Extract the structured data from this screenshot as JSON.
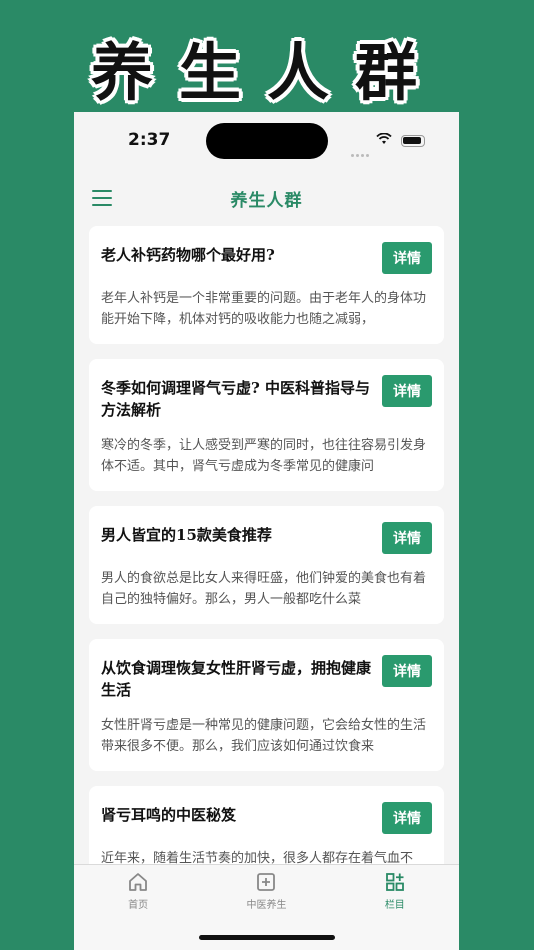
{
  "banner": {
    "title": "养生人群"
  },
  "status_bar": {
    "time": "2:37"
  },
  "navbar": {
    "title": "养生人群"
  },
  "articles": [
    {
      "title": "老人补钙药物哪个最好用?",
      "button": "详情",
      "excerpt": "老年人补钙是一个非常重要的问题。由于老年人的身体功能开始下降，机体对钙的吸收能力也随之减弱，"
    },
    {
      "title": "冬季如何调理肾气亏虚? 中医科普指导与方法解析",
      "button": "详情",
      "excerpt": "寒冷的冬季，让人感受到严寒的同时，也往往容易引发身体不适。其中，肾气亏虚成为冬季常见的健康问"
    },
    {
      "title": "男人皆宜的15款美食推荐",
      "button": "详情",
      "excerpt": "男人的食欲总是比女人来得旺盛，他们钟爱的美食也有着自己的独特偏好。那么，男人一般都吃什么菜"
    },
    {
      "title": "从饮食调理恢复女性肝肾亏虚，拥抱健康生活",
      "button": "详情",
      "excerpt": "女性肝肾亏虚是一种常见的健康问题，它会给女性的生活带来很多不便。那么，我们应该如何通过饮食来"
    },
    {
      "title": "肾亏耳鸣的中医秘笈",
      "button": "详情",
      "excerpt": "近年来，随着生活节奏的加快，很多人都存在着气血不足、肾亏耳鸣的健康问题。气血不足和肾亏是中医"
    }
  ],
  "tabbar": {
    "items": [
      {
        "label": "首页",
        "icon": "home-icon"
      },
      {
        "label": "中医养生",
        "icon": "plus-square-icon"
      },
      {
        "label": "栏目",
        "icon": "grid-plus-icon"
      }
    ],
    "active": "栏目"
  },
  "colors": {
    "accent": "#2a8a66",
    "button": "#2a9a6e"
  }
}
